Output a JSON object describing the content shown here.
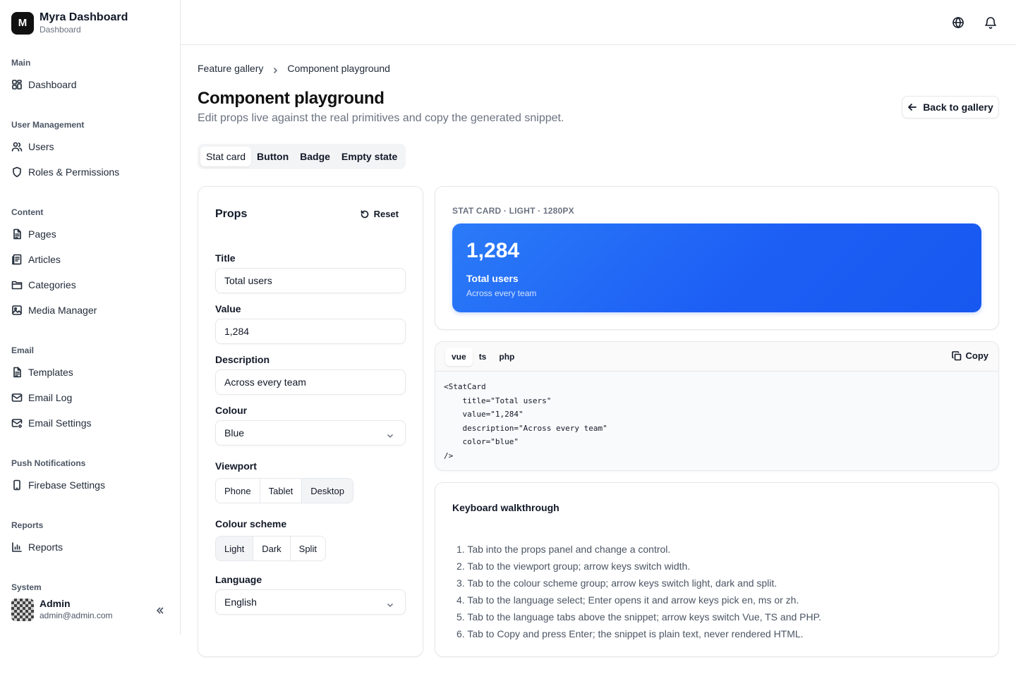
{
  "app": {
    "name": "Myra Dashboard",
    "subtitle": "Dashboard",
    "logo_letter": "M"
  },
  "sidebar": {
    "sections": [
      {
        "title": "Main",
        "items": [
          {
            "label": "Dashboard",
            "icon": "dashboard-icon"
          }
        ]
      },
      {
        "title": "User Management",
        "items": [
          {
            "label": "Users",
            "icon": "users-icon"
          },
          {
            "label": "Roles & Permissions",
            "icon": "shield-icon"
          }
        ]
      },
      {
        "title": "Content",
        "items": [
          {
            "label": "Pages",
            "icon": "file-icon"
          },
          {
            "label": "Articles",
            "icon": "articles-icon"
          },
          {
            "label": "Categories",
            "icon": "folder-icon"
          },
          {
            "label": "Media Manager",
            "icon": "image-icon"
          }
        ]
      },
      {
        "title": "Email",
        "items": [
          {
            "label": "Templates",
            "icon": "file-icon"
          },
          {
            "label": "Email Log",
            "icon": "mail-icon"
          },
          {
            "label": "Email Settings",
            "icon": "mail-settings-icon"
          }
        ]
      },
      {
        "title": "Push Notifications",
        "items": [
          {
            "label": "Firebase Settings",
            "icon": "phone-icon"
          }
        ]
      },
      {
        "title": "Reports",
        "items": [
          {
            "label": "Reports",
            "icon": "bar-chart-icon"
          }
        ]
      },
      {
        "title": "System",
        "items": []
      }
    ],
    "user": {
      "name": "Admin",
      "email": "admin@admin.com"
    }
  },
  "header": {
    "icons": [
      "globe-icon",
      "bell-icon"
    ]
  },
  "breadcrumb": [
    "Feature gallery",
    "Component playground"
  ],
  "page": {
    "title": "Component playground",
    "subtitle": "Edit props live against the real primitives and copy the generated snippet.",
    "back_label": "Back to gallery"
  },
  "component_tabs": [
    {
      "label": "Stat card",
      "active": true
    },
    {
      "label": "Button",
      "active": false
    },
    {
      "label": "Badge",
      "active": false
    },
    {
      "label": "Empty state",
      "active": false
    }
  ],
  "props": {
    "title": "Props",
    "reset_label": "Reset",
    "fields": {
      "title": {
        "label": "Title",
        "value": "Total users"
      },
      "value": {
        "label": "Value",
        "value": "1,284"
      },
      "description": {
        "label": "Description",
        "value": "Across every team"
      },
      "colour": {
        "label": "Colour",
        "value": "Blue"
      },
      "language": {
        "label": "Language",
        "value": "English"
      }
    },
    "viewport": {
      "label": "Viewport",
      "options": [
        "Phone",
        "Tablet",
        "Desktop"
      ],
      "selected": "Desktop"
    },
    "scheme": {
      "label": "Colour scheme",
      "options": [
        "Light",
        "Dark",
        "Split"
      ],
      "selected": "Light"
    }
  },
  "preview": {
    "caption": "STAT CARD · LIGHT · 1280PX",
    "stat": {
      "value": "1,284",
      "title": "Total users",
      "description": "Across every team"
    },
    "accent": "#1d5ff5"
  },
  "code": {
    "tabs": [
      {
        "label": "vue",
        "active": true
      },
      {
        "label": "ts",
        "active": false
      },
      {
        "label": "php",
        "active": false
      }
    ],
    "copy_label": "Copy",
    "lines": [
      "<StatCard",
      "    title=\"Total users\"",
      "    value=\"1,284\"",
      "    description=\"Across every team\"",
      "    color=\"blue\"",
      "/>"
    ]
  },
  "walkthrough": {
    "title": "Keyboard walkthrough",
    "steps": [
      "1. Tab into the props panel and change a control.",
      "2. Tab to the viewport group; arrow keys switch width.",
      "3. Tab to the colour scheme group; arrow keys switch light, dark and split.",
      "4. Tab to the language select; Enter opens it and arrow keys pick en, ms or zh.",
      "5. Tab to the language tabs above the snippet; arrow keys switch Vue, TS and PHP.",
      "6. Tab to Copy and press Enter; the snippet is plain text, never rendered HTML."
    ]
  }
}
